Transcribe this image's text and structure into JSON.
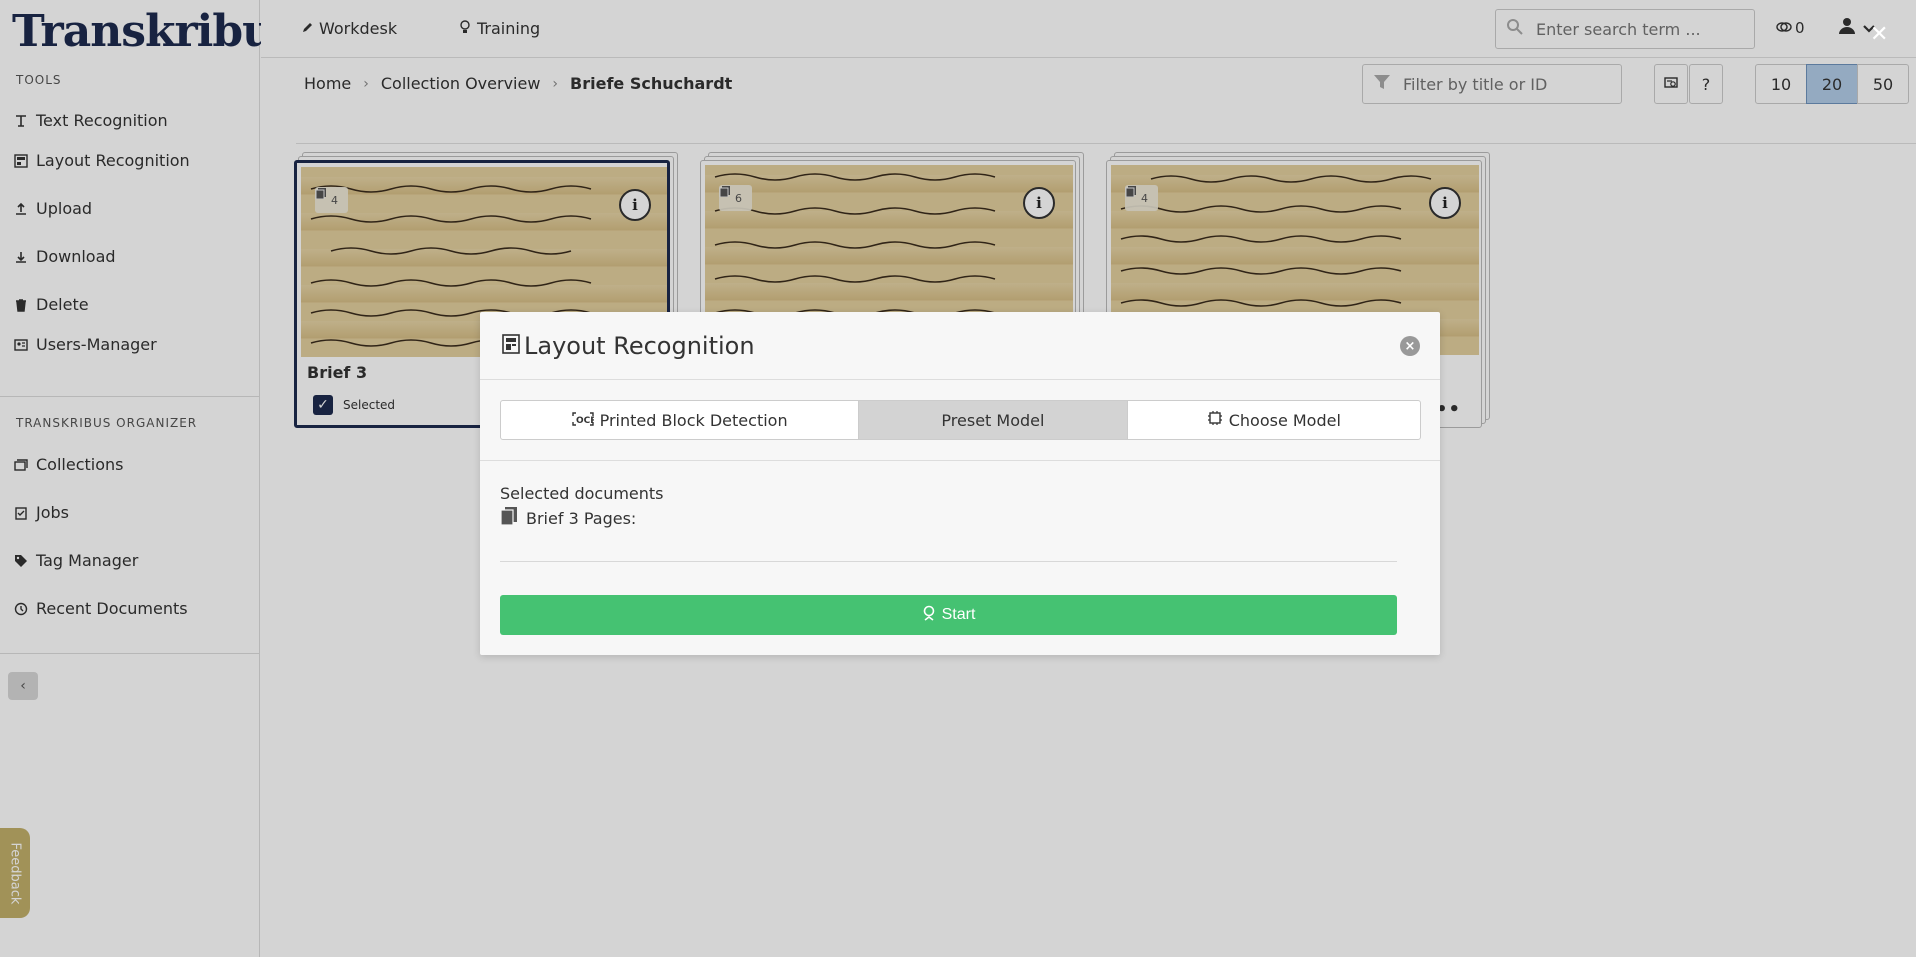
{
  "brand": {
    "logo_text": "Transkribus",
    "registered": "®"
  },
  "header": {
    "nav": [
      {
        "label": "Workdesk",
        "icon": "pen-icon"
      },
      {
        "label": "Training",
        "icon": "lightbulb-icon"
      }
    ],
    "search_placeholder": "Enter search term ...",
    "credits": "0"
  },
  "sidebar": {
    "tools_heading": "TOOLS",
    "tools": [
      {
        "label": "Text Recognition",
        "icon": "text-recognition-icon"
      },
      {
        "label": "Layout Recognition",
        "icon": "layout-recognition-icon"
      },
      {
        "label": "Upload",
        "icon": "upload-icon"
      },
      {
        "label": "Download",
        "icon": "download-icon"
      },
      {
        "label": "Delete",
        "icon": "trash-icon"
      },
      {
        "label": "Users-Manager",
        "icon": "users-manager-icon"
      }
    ],
    "organizer_heading": "TRANSKRIBUS ORGANIZER",
    "organizer": [
      {
        "label": "Collections",
        "icon": "collections-icon"
      },
      {
        "label": "Jobs",
        "icon": "jobs-icon"
      },
      {
        "label": "Tag Manager",
        "icon": "tag-icon"
      },
      {
        "label": "Recent Documents",
        "icon": "history-icon"
      }
    ],
    "collapse_label": "‹"
  },
  "breadcrumb": [
    "Home",
    "Collection Overview",
    "Briefe Schuchardt"
  ],
  "filter_placeholder": "Filter by title or ID",
  "toolbar": {
    "help_label": "?"
  },
  "page_size": {
    "options": [
      "10",
      "20",
      "50"
    ],
    "selected": "20"
  },
  "documents": [
    {
      "title": "Brief 3",
      "pages": "4",
      "selected": true,
      "selected_label": "Selected"
    },
    {
      "title": "",
      "pages": "6",
      "selected": false
    },
    {
      "title": "",
      "pages": "4",
      "selected": false
    }
  ],
  "modal": {
    "title": "Layout Recognition",
    "tabs": [
      {
        "label": "Printed Block Detection",
        "icon": "ocr-icon",
        "active": false
      },
      {
        "label": "Preset Model",
        "icon": "",
        "active": true
      },
      {
        "label": "Choose Model",
        "icon": "chip-icon",
        "active": false
      }
    ],
    "selected_documents_label": "Selected documents",
    "selected_doc": "Brief 3 Pages:",
    "start_label": "Start"
  },
  "feedback_label": "Feedback",
  "colors": {
    "brand": "#1d2b4f",
    "start_button": "#45c272",
    "active_page_size": "#b3cde9",
    "feedback": "#c2b06a"
  }
}
